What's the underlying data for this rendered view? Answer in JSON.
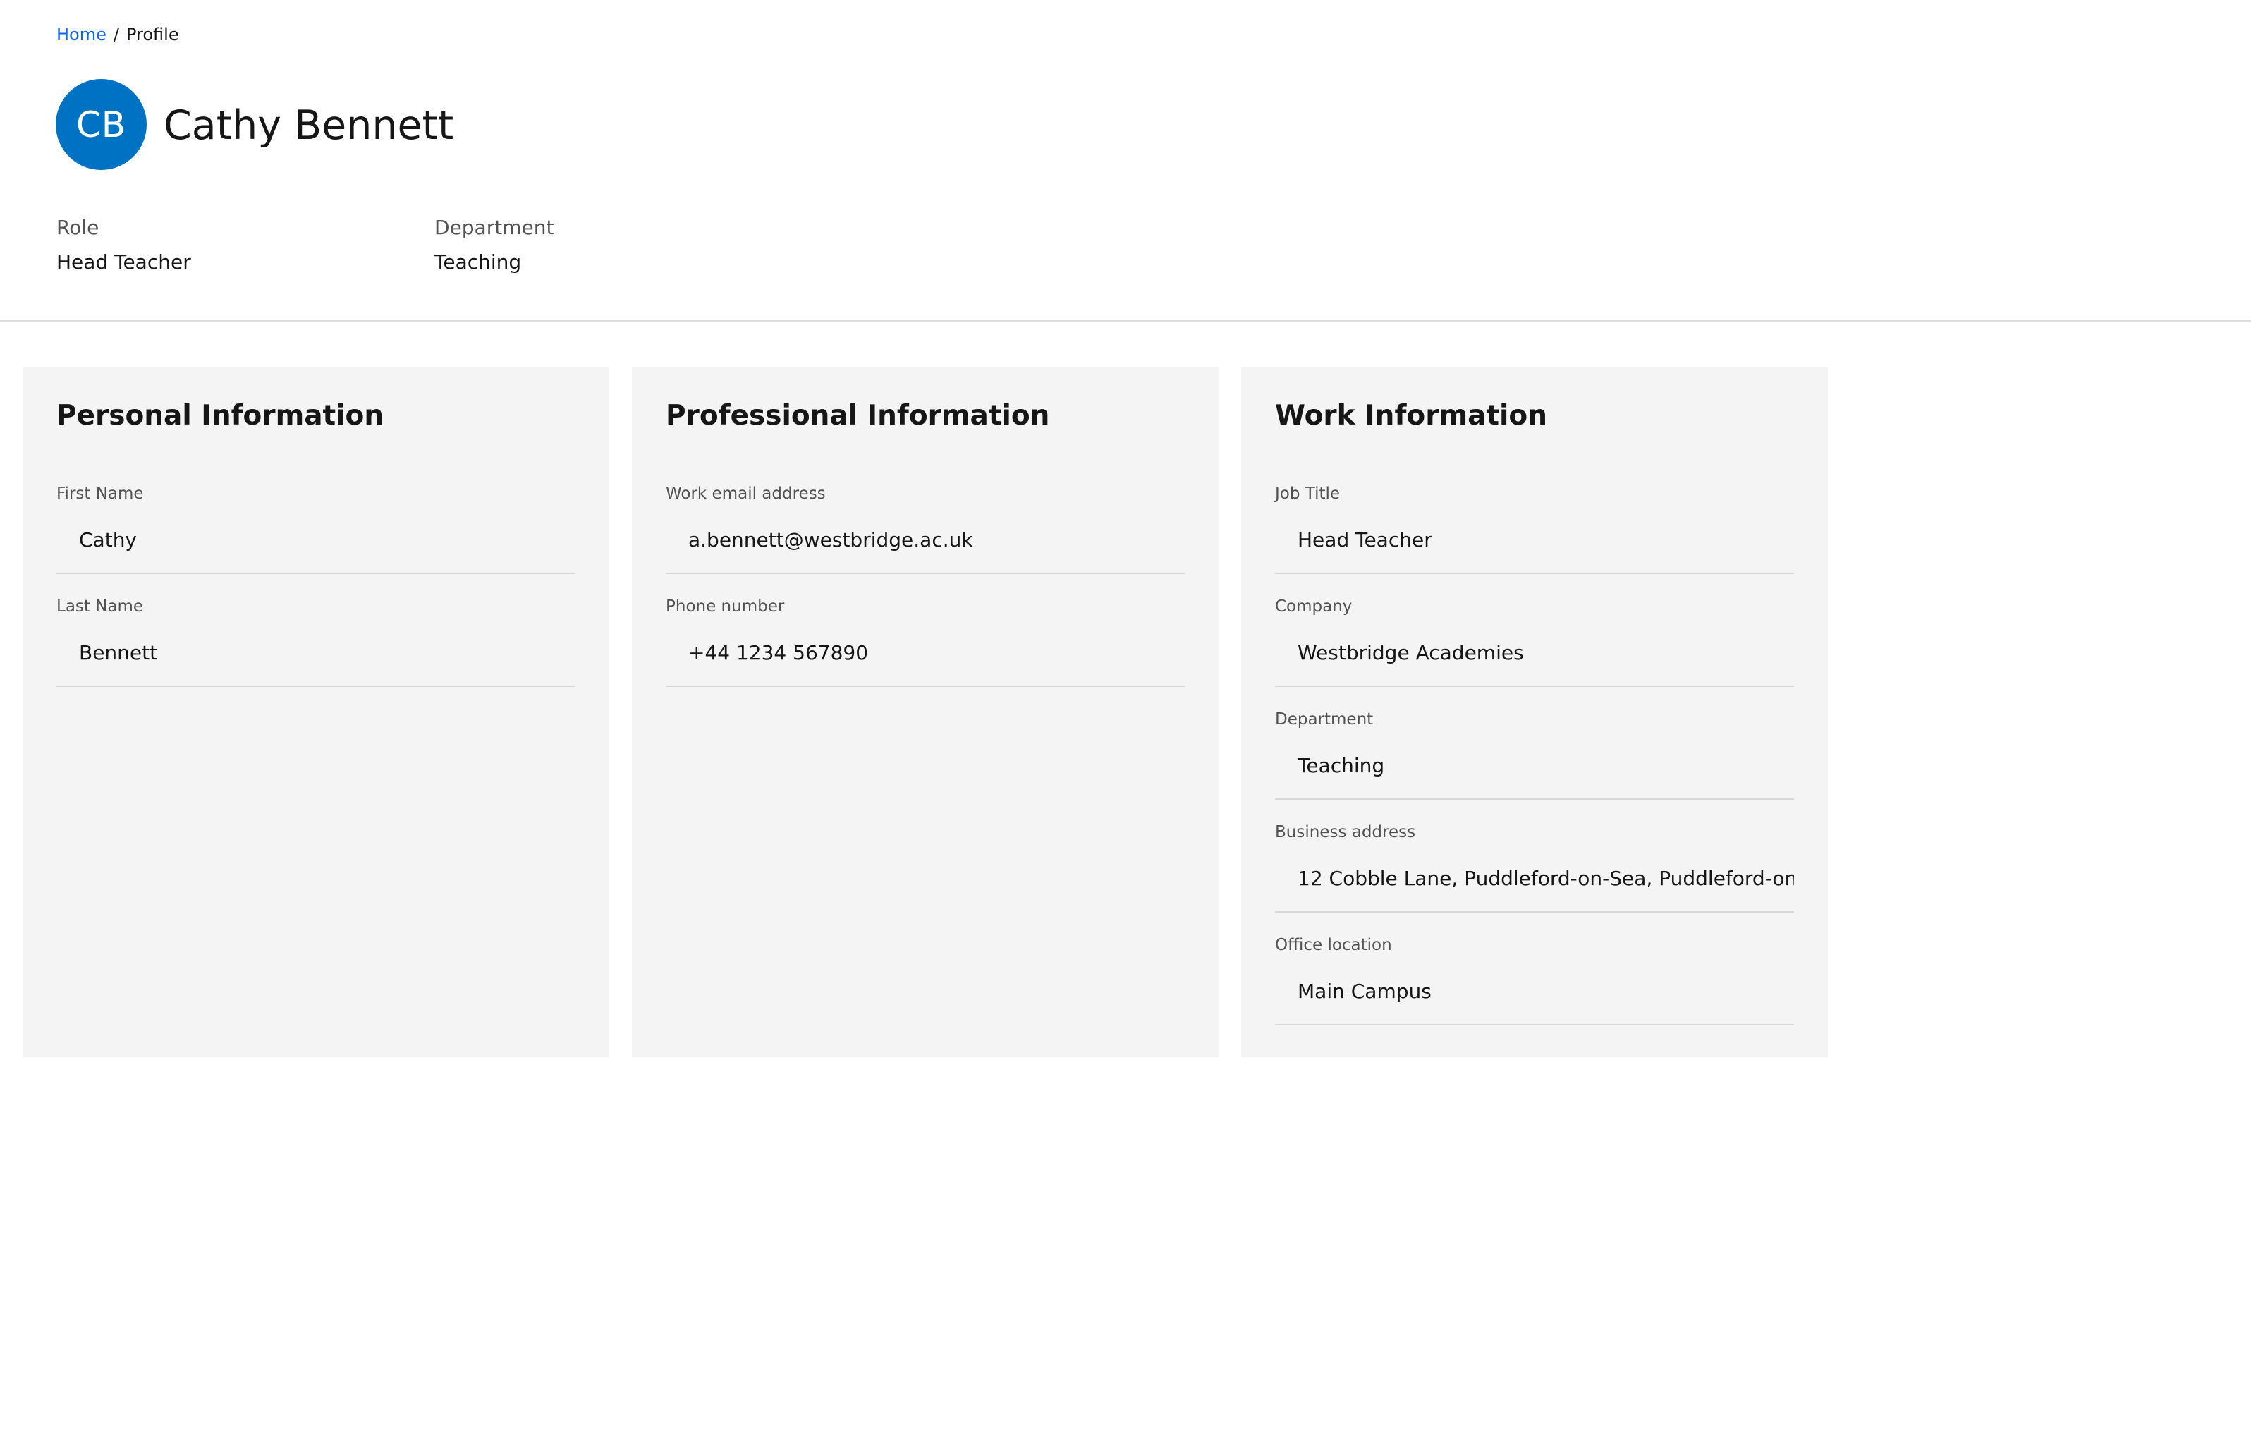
{
  "breadcrumb": {
    "home": "Home",
    "separator": "/",
    "current": "Profile"
  },
  "profile": {
    "initials": "CB",
    "name": "Cathy Bennett",
    "role_label": "Role",
    "role_value": "Head Teacher",
    "department_label": "Department",
    "department_value": "Teaching"
  },
  "cards": {
    "personal": {
      "title": "Personal Information",
      "fields": [
        {
          "label": "First Name",
          "value": "Cathy"
        },
        {
          "label": "Last Name",
          "value": "Bennett"
        }
      ]
    },
    "professional": {
      "title": "Professional Information",
      "fields": [
        {
          "label": "Work email address",
          "value": "a.bennett@westbridge.ac.uk"
        },
        {
          "label": "Phone number",
          "value": "+44 1234 567890"
        }
      ]
    },
    "work": {
      "title": "Work Information",
      "fields": [
        {
          "label": "Job Title",
          "value": "Head Teacher"
        },
        {
          "label": "Company",
          "value": "Westbridge Academies"
        },
        {
          "label": "Department",
          "value": "Teaching"
        },
        {
          "label": "Business address",
          "value": "12 Cobble Lane, Puddleford-on-Sea, Puddleford-on-"
        },
        {
          "label": "Office location",
          "value": "Main Campus"
        }
      ]
    }
  },
  "colors": {
    "link": "#0f62fe",
    "avatar": "#0072c3",
    "card_background": "#f4f4f4",
    "divider": "#e0e0e0"
  }
}
